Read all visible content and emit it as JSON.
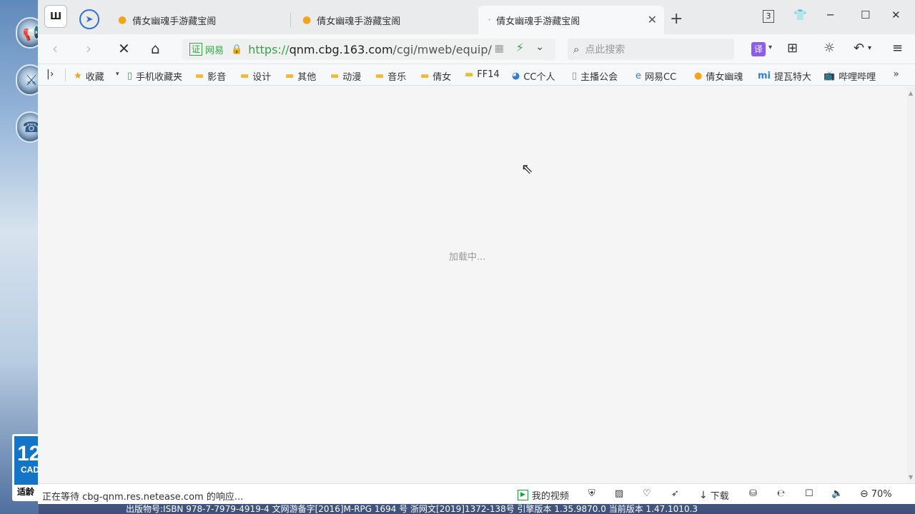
{
  "browser": {
    "logo_text": "Ш",
    "tabs": [
      {
        "label": "倩女幽魂手游藏宝阁",
        "icon": "yellow-chick-icon"
      },
      {
        "label": "倩女幽魂手游藏宝阁",
        "icon": "yellow-chick-icon"
      },
      {
        "label": "倩女幽魂手游藏宝阁",
        "icon": "loading-icon",
        "active": true
      }
    ],
    "tab_count": "3"
  },
  "toolbar": {
    "cert_label": "证",
    "cert_name": "网易",
    "url_scheme": "https://",
    "url_host": "qnm.cbg.163.com",
    "url_path": "/cgi/mweb/equip/",
    "search_placeholder": "点此搜索",
    "translate_label": "译"
  },
  "bookmarks": [
    {
      "label": "收藏",
      "icon": "star-icon"
    },
    {
      "label": "手机收藏夹",
      "icon": "phone-icon"
    },
    {
      "label": "影音",
      "icon": "folder-icon"
    },
    {
      "label": "设计",
      "icon": "folder-icon"
    },
    {
      "label": "其他",
      "icon": "folder-icon"
    },
    {
      "label": "动漫",
      "icon": "folder-icon"
    },
    {
      "label": "音乐",
      "icon": "folder-icon"
    },
    {
      "label": "倩女",
      "icon": "folder-icon"
    },
    {
      "label": "FF14",
      "icon": "folder-icon"
    },
    {
      "label": "CC个人",
      "icon": "cc-icon"
    },
    {
      "label": "主播公会",
      "icon": "page-icon"
    },
    {
      "label": "网易CC",
      "icon": "ie-icon"
    },
    {
      "label": "倩女幽魂",
      "icon": "yellow-chick-icon"
    },
    {
      "label": "提瓦特大",
      "icon": "mi-icon"
    },
    {
      "label": "哔哩哔哩",
      "icon": "bilibili-icon"
    }
  ],
  "content": {
    "loading_text": "加载中..."
  },
  "statusbar": {
    "status_text": "正在等待 cbg-qnm.res.netease.com 的响应...",
    "my_video": "我的视频",
    "download": "下载",
    "zoom": "70%"
  },
  "desktop": {
    "age_num": "12",
    "age_cad": "CAD",
    "age_label": "适龄",
    "footer_text": "出版物号:ISBN 978-7-7979-4919-4   文网游备字[2016]M-RPG 1694 号   浙网文[2019]1372-138号   引擎版本 1.35.9870.0   当前版本 1.47.1010.3"
  }
}
